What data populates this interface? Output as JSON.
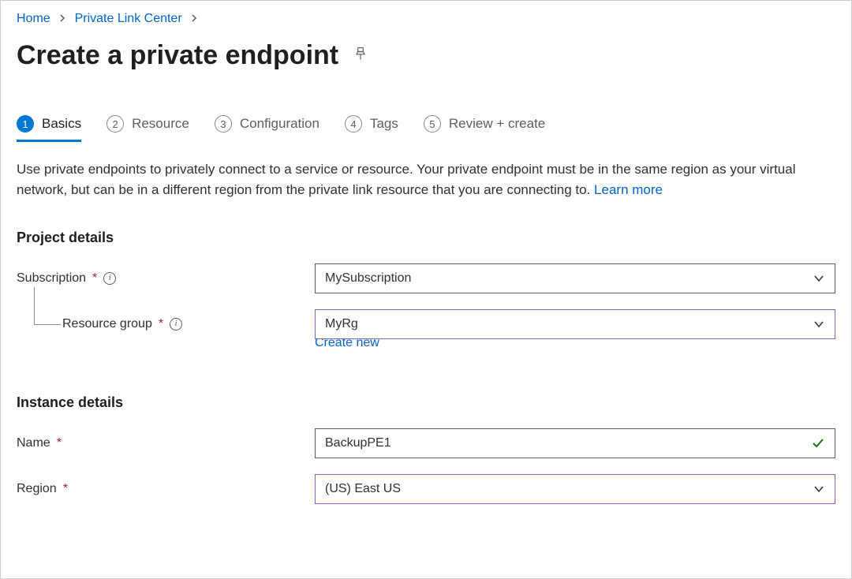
{
  "breadcrumb": {
    "home": "Home",
    "privateLinkCenter": "Private Link Center"
  },
  "pageTitle": "Create a private endpoint",
  "tabs": {
    "basics": {
      "number": "1",
      "label": "Basics"
    },
    "resource": {
      "number": "2",
      "label": "Resource"
    },
    "configuration": {
      "number": "3",
      "label": "Configuration"
    },
    "tags": {
      "number": "4",
      "label": "Tags"
    },
    "review": {
      "number": "5",
      "label": "Review + create"
    }
  },
  "description": {
    "text": "Use private endpoints to privately connect to a service or resource. Your private endpoint must be in the same region as your virtual network, but can be in a different region from the private link resource that you are connecting to.  ",
    "learnMore": "Learn more"
  },
  "sections": {
    "project": {
      "title": "Project details",
      "subscription": {
        "label": "Subscription",
        "value": "MySubscription"
      },
      "resourceGroup": {
        "label": "Resource group",
        "value": "MyRg",
        "createNew": "Create new"
      }
    },
    "instance": {
      "title": "Instance details",
      "name": {
        "label": "Name",
        "value": "BackupPE1"
      },
      "region": {
        "label": "Region",
        "value": "(US) East US"
      }
    }
  },
  "symbols": {
    "required": "*",
    "info": "i",
    "chevron": ">"
  }
}
